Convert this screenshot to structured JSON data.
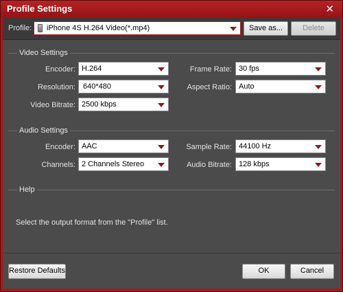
{
  "window": {
    "title": "Profile Settings",
    "close_glyph": "✕"
  },
  "profile": {
    "label": "Profile:",
    "value": "iPhone 4S H.264 Video(*.mp4)",
    "icon": "phone-icon",
    "save_as": "Save as...",
    "delete": "Delete"
  },
  "video": {
    "title": "Video Settings",
    "encoder_label": "Encoder:",
    "encoder": "H.264",
    "resolution_label": "Resolution:",
    "resolution": "640*480",
    "bitrate_label": "Video Bitrate:",
    "bitrate": "2500 kbps",
    "framerate_label": "Frame Rate:",
    "framerate": "30 fps",
    "aspect_label": "Aspect Ratio:",
    "aspect": "Auto"
  },
  "audio": {
    "title": "Audio Settings",
    "encoder_label": "Encoder:",
    "encoder": "AAC",
    "channels_label": "Channels:",
    "channels": "2 Channels Stereo",
    "samplerate_label": "Sample Rate:",
    "samplerate": "44100 Hz",
    "bitrate_label": "Audio Bitrate:",
    "bitrate": "128 kbps"
  },
  "help": {
    "title": "Help",
    "text": "Select the output format from the \"Profile\" list."
  },
  "footer": {
    "restore": "Restore Defaults",
    "ok": "OK",
    "cancel": "Cancel"
  },
  "colors": {
    "titlebar": "#a11a1c",
    "panel": "#4b4b4b",
    "accent_arrow": "#8c1a1c"
  }
}
